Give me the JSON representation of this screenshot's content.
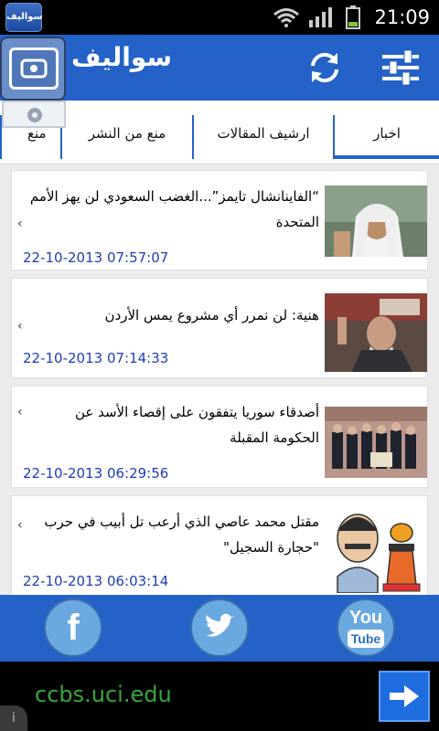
{
  "status_bar": {
    "time": "21:09",
    "notification_app": "سواليف"
  },
  "header": {
    "app_title": "سواليف"
  },
  "tabs": [
    {
      "label": "اخبار",
      "active": true
    },
    {
      "label": "ارشيف المقالات",
      "active": false
    },
    {
      "label": "منع من النشر",
      "active": false
    },
    {
      "label": "منع",
      "active": false
    }
  ],
  "news": [
    {
      "title": "“الفاينانشال تايمز”...الغضب السعودي لن يهز الأمم المتحدة",
      "date": "22-10-2013 07:57:07"
    },
    {
      "title": "هنية: لن نمرر أي مشروع يمس الأردن",
      "date": "22-10-2013 07:14:33"
    },
    {
      "title": "أصدقاء سوريا يتفقون على إقصاء الأسد عن الحكومة المقبلة",
      "date": "22-10-2013 06:29:56"
    },
    {
      "title": "مقتل محمد عاصي  الذي أرعب تل أبيب في حرب \"حجارة السجيل\"",
      "date": "22-10-2013 06:03:14"
    }
  ],
  "social": {
    "facebook": "f",
    "youtube_top": "You",
    "youtube_bottom": "Tube"
  },
  "ad": {
    "text": "ccbs.uci.edu",
    "info": "i"
  },
  "colors": {
    "primary": "#2462c7",
    "date_text": "#1f3db8",
    "ad_text": "#38a63c"
  }
}
